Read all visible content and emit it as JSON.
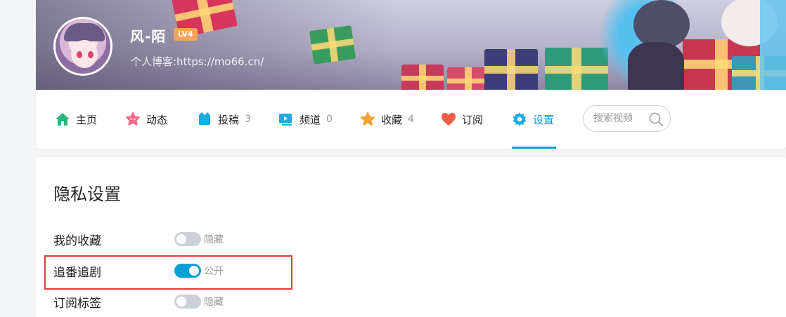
{
  "profile": {
    "username": "风-陌",
    "level": "LV4",
    "blog": "个人博客:https://mo66.cn/"
  },
  "nav": {
    "items": [
      {
        "label": "主页",
        "icon": "home-icon",
        "color": "#2ab67d"
      },
      {
        "label": "动态",
        "icon": "dynamic-icon",
        "color": "#f26c8a"
      },
      {
        "label": "投稿",
        "count": "3",
        "icon": "upload-icon",
        "color": "#1dabe2"
      },
      {
        "label": "频道",
        "count": "0",
        "icon": "channel-icon",
        "color": "#1dabe2"
      },
      {
        "label": "收藏",
        "count": "4",
        "icon": "favorite-star-icon",
        "color": "#f3a034"
      },
      {
        "label": "订阅",
        "icon": "subscribe-heart-icon",
        "color": "#f25d48"
      },
      {
        "label": "设置",
        "icon": "settings-gear-icon",
        "color": "#1dabe2",
        "active": true
      }
    ],
    "search_placeholder": "搜索视频"
  },
  "privacy": {
    "title": "隐私设置",
    "rows": [
      {
        "label": "我的收藏",
        "state": "隐藏",
        "enabled": false
      },
      {
        "label": "追番追剧",
        "state": "公开",
        "enabled": true
      },
      {
        "label": "订阅标签",
        "state": "隐藏",
        "enabled": false
      }
    ]
  },
  "colors": {
    "accent": "#00a1d6",
    "highlight_box": "#e23a3a"
  }
}
